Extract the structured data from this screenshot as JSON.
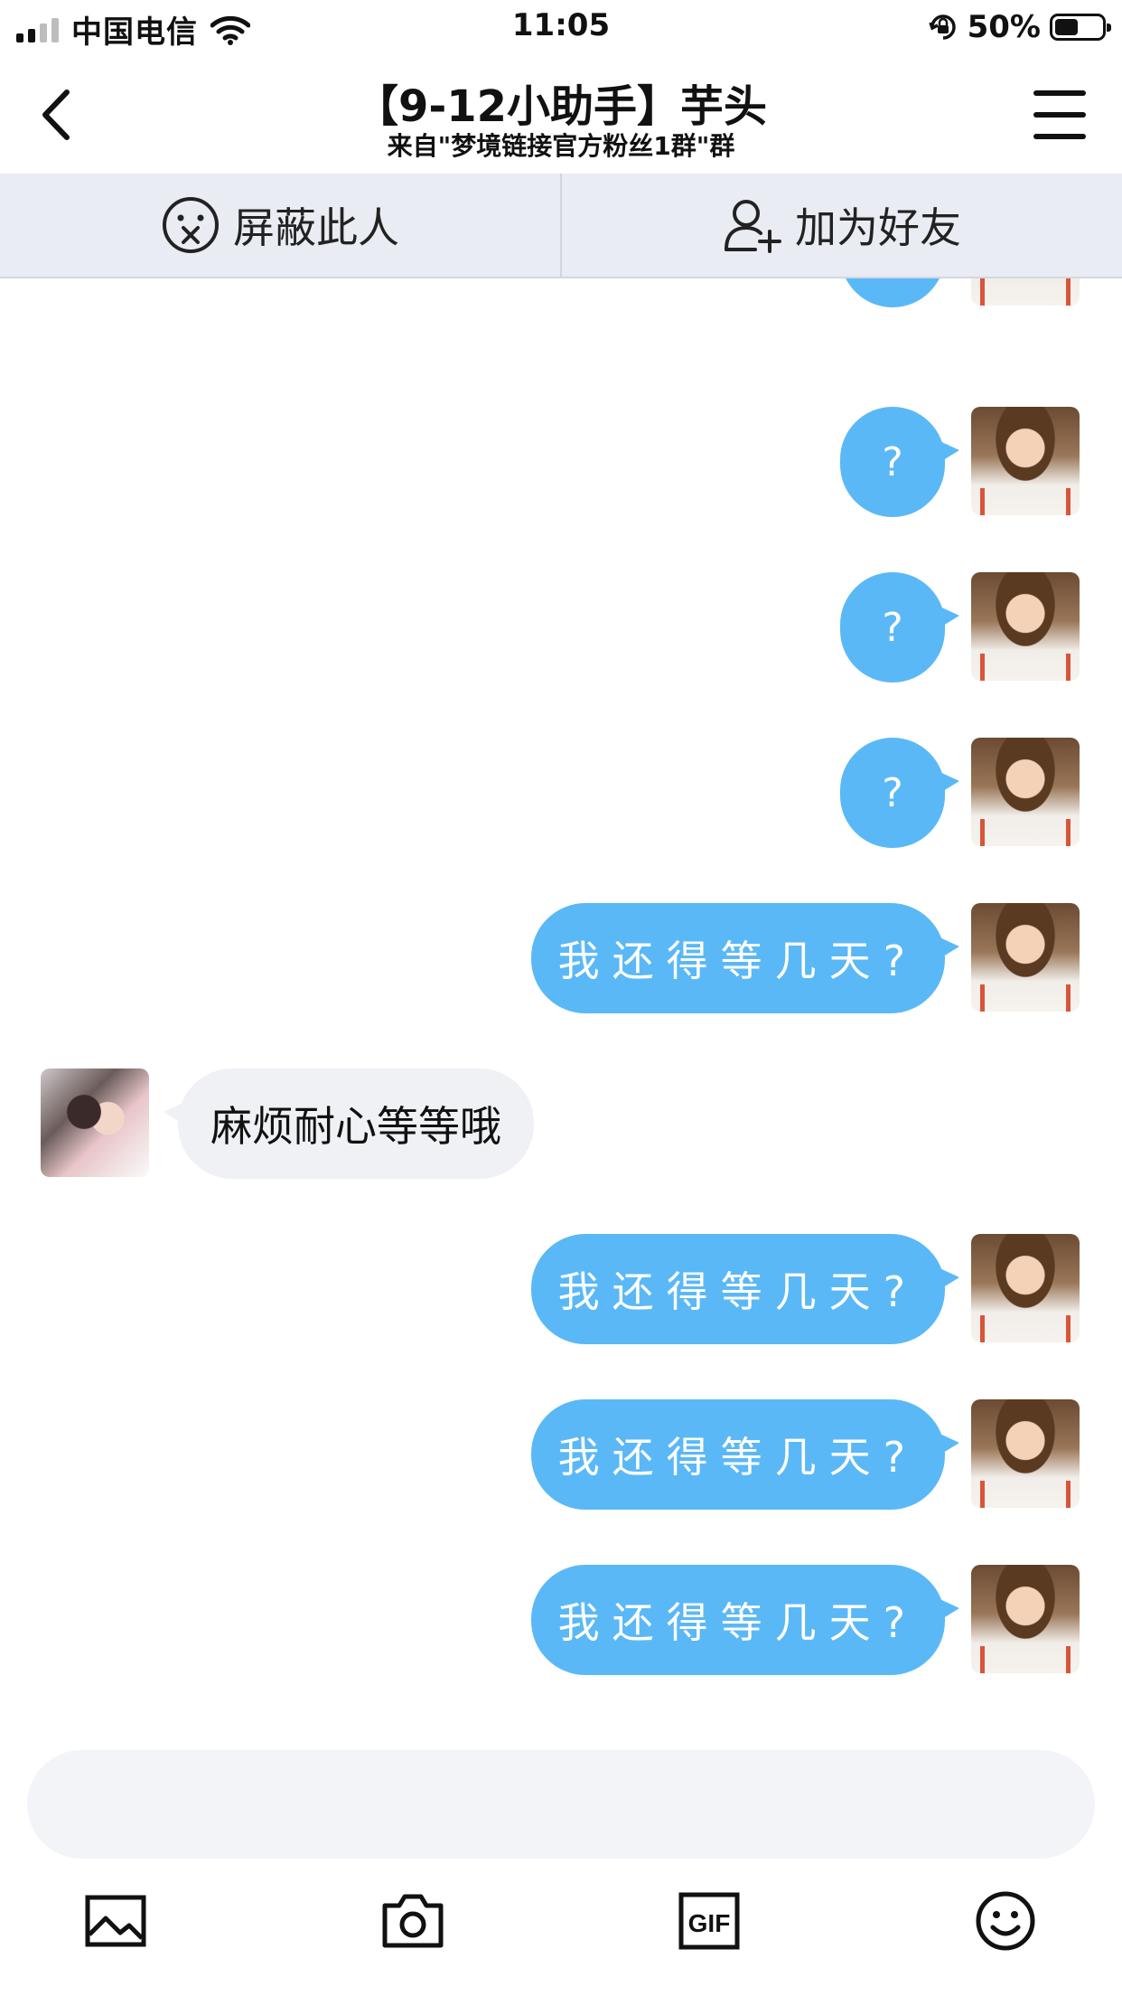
{
  "status_bar": {
    "carrier": "中国电信",
    "time": "11:05",
    "battery": "50%",
    "battery_level": 0.5
  },
  "nav": {
    "title": "【9-12小助手】芋头",
    "subtitle": "来自\"梦境链接官方粉丝1群\"群"
  },
  "actions": {
    "block_label": "屏蔽此人",
    "add_friend_label": "加为好友"
  },
  "messages": [
    {
      "from": "me",
      "text": "?"
    },
    {
      "from": "me",
      "text": "?"
    },
    {
      "from": "me",
      "text": "?"
    },
    {
      "from": "me",
      "text": "?"
    },
    {
      "from": "me",
      "text": "我还得等几天?"
    },
    {
      "from": "other",
      "text": "麻烦耐心等等哦"
    },
    {
      "from": "me",
      "text": "我还得等几天?"
    },
    {
      "from": "me",
      "text": "我还得等几天?"
    },
    {
      "from": "me",
      "text": "我还得等几天?"
    }
  ],
  "input": {
    "placeholder": ""
  },
  "tools": [
    "image-icon",
    "camera-icon",
    "gif-icon",
    "emoji-icon"
  ],
  "colors": {
    "my_bubble": "#5bb8f6",
    "other_bubble": "#eff1f5",
    "action_bar": "#e9ecf3"
  }
}
